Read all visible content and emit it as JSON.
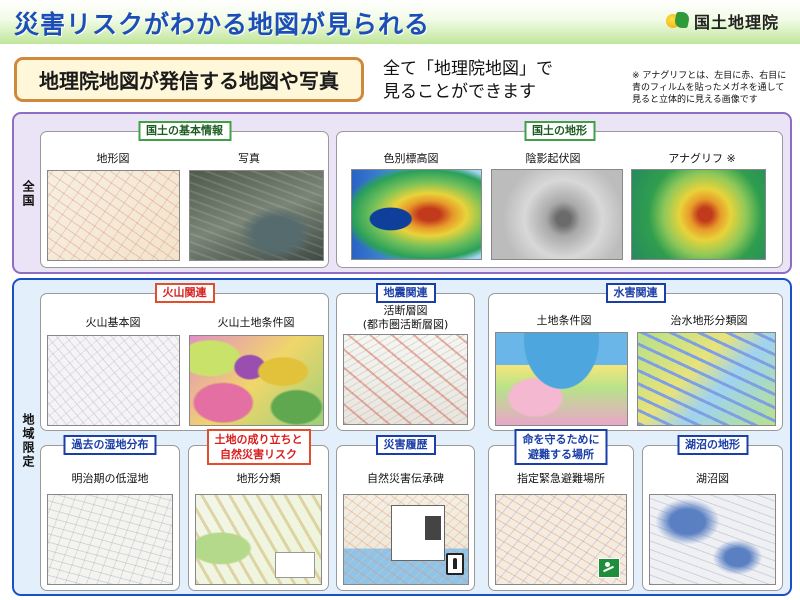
{
  "header": {
    "title": "災害リスクがわかる地図が見られる",
    "logo_text": "国土地理院"
  },
  "intro": {
    "subtitle": "地理院地図が発信する地図や写真",
    "subtext_line1": "全て「地理院地図」で",
    "subtext_line2": "見ることができます",
    "footnote_line1": "※ アナグリフとは、左目に赤、右目に",
    "footnote_line2": "青のフィルムを貼ったメガネを通して",
    "footnote_line3": "見ると立体的に見える画像です"
  },
  "regions": {
    "national": "全国",
    "local": "地域限定"
  },
  "national": {
    "basic": {
      "tag": "国土の基本情報",
      "items": [
        "地形図",
        "写真"
      ]
    },
    "terrain": {
      "tag": "国土の地形",
      "items": [
        "色別標高図",
        "陰影起伏図",
        "アナグリフ ※"
      ]
    }
  },
  "local": {
    "volcano": {
      "tag": "火山関連",
      "items": [
        "火山基本図",
        "火山土地条件図"
      ]
    },
    "quake": {
      "tag": "地震関連",
      "item_line1": "活断層図",
      "item_line2": "(都市圏活断層図)"
    },
    "flood": {
      "tag": "水害関連",
      "items": [
        "土地条件図",
        "治水地形分類図"
      ]
    },
    "wetland": {
      "tag": "過去の湿地分布",
      "item": "明治期の低湿地"
    },
    "landform": {
      "tag_line1": "土地の成り立ちと",
      "tag_line2": "自然災害リスク",
      "item": "地形分類"
    },
    "history": {
      "tag": "災害履歴",
      "item": "自然災害伝承碑"
    },
    "evacuation": {
      "tag_line1": "命を守るために",
      "tag_line2": "避難する場所",
      "item": "指定緊急避難場所"
    },
    "lake": {
      "tag": "湖沼の地形",
      "item": "湖沼図"
    }
  },
  "colors": {
    "title": "#1c4fb6",
    "national_border": "#8e6dc3",
    "local_border": "#1b4fc6",
    "green_tag": "#41a047",
    "red_tag": "#d81e1e",
    "navy_tag": "#1b3fa8"
  }
}
